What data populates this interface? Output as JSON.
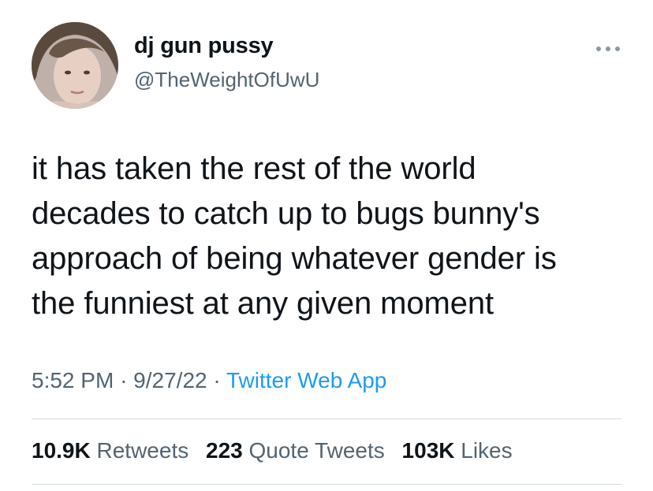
{
  "author": {
    "display_name": "dj gun pussy",
    "handle": "@TheWeightOfUwU"
  },
  "tweet": {
    "lines": [
      "it has taken the rest of the world",
      "decades to catch up to bugs bunny's",
      "approach of being whatever gender is",
      "the funniest at any given moment"
    ]
  },
  "meta": {
    "time": "5:52 PM",
    "sep1": "·",
    "date": "9/27/22",
    "sep2": "·",
    "source": "Twitter Web App"
  },
  "stats": {
    "retweets": {
      "count": "10.9K",
      "label": "Retweets"
    },
    "quotes": {
      "count": "223",
      "label": "Quote Tweets"
    },
    "likes": {
      "count": "103K",
      "label": "Likes"
    }
  },
  "colors": {
    "text_primary": "#0f1419",
    "text_secondary": "#536471",
    "link": "#1d9bf0",
    "divider": "#cfd9de"
  },
  "icons": {
    "more": "more-horizontal-icon"
  }
}
